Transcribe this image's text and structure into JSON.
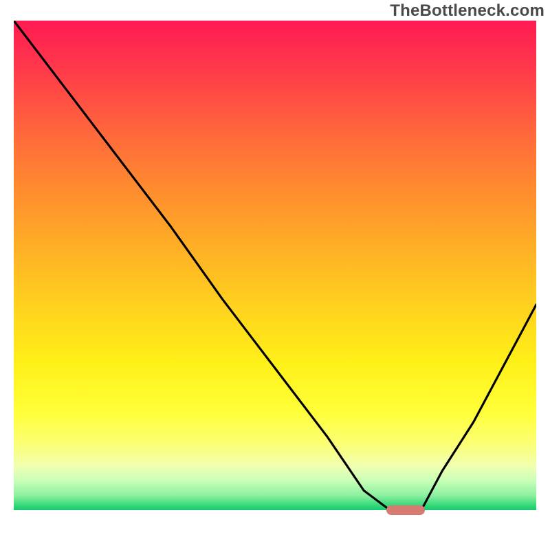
{
  "watermark": "TheBottleneck.com",
  "chart_data": {
    "type": "line",
    "title": "",
    "xlabel": "",
    "ylabel": "",
    "xlim": [
      0,
      100
    ],
    "ylim": [
      0,
      100
    ],
    "grid": false,
    "series": [
      {
        "name": "bottleneck-curve",
        "x": [
          0,
          10,
          20,
          30,
          40,
          50,
          60,
          67,
          72,
          78,
          82,
          88,
          94,
          100
        ],
        "values": [
          100,
          86,
          72,
          58,
          43,
          29,
          15,
          4,
          0,
          0,
          8,
          18,
          30,
          42
        ]
      }
    ],
    "marker": {
      "x": 75,
      "y": 0,
      "label": ""
    },
    "gradient": {
      "top_color": "#ff1a53",
      "mid_color": "#fff018",
      "bottom_color": "#16c96e"
    }
  }
}
